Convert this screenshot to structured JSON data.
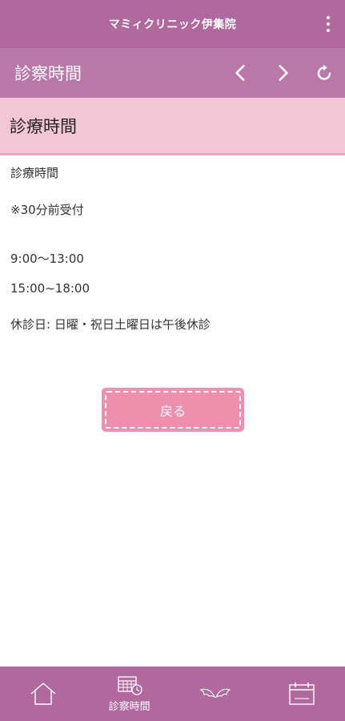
{
  "appbar": {
    "title": "マミィクリニック伊集院",
    "menu_icon": "more-vertical-icon"
  },
  "navbar": {
    "title": "診察時間",
    "icons": [
      "chevron-left-icon",
      "chevron-right-icon",
      "refresh-icon"
    ]
  },
  "page": {
    "heading": "診療時間",
    "lines": [
      "診療時間",
      "※30分前受付",
      "9:00〜13:00",
      "15:00~18:00",
      "休診日: 日曜・祝日土曜日は午後休診"
    ],
    "back_label": "戻る"
  },
  "tabbar": {
    "tabs": [
      {
        "icon": "home-icon",
        "label": ""
      },
      {
        "icon": "calendar-clock-icon",
        "label": "診察時間"
      },
      {
        "icon": "wings-icon",
        "label": ""
      },
      {
        "icon": "calendar-icon",
        "label": ""
      }
    ]
  },
  "colors": {
    "appbar": "#b0689f",
    "navbar": "#ba78aa",
    "header_band": "#f3c6d5",
    "header_border": "#e8a7be",
    "button": "#ee8fae"
  }
}
